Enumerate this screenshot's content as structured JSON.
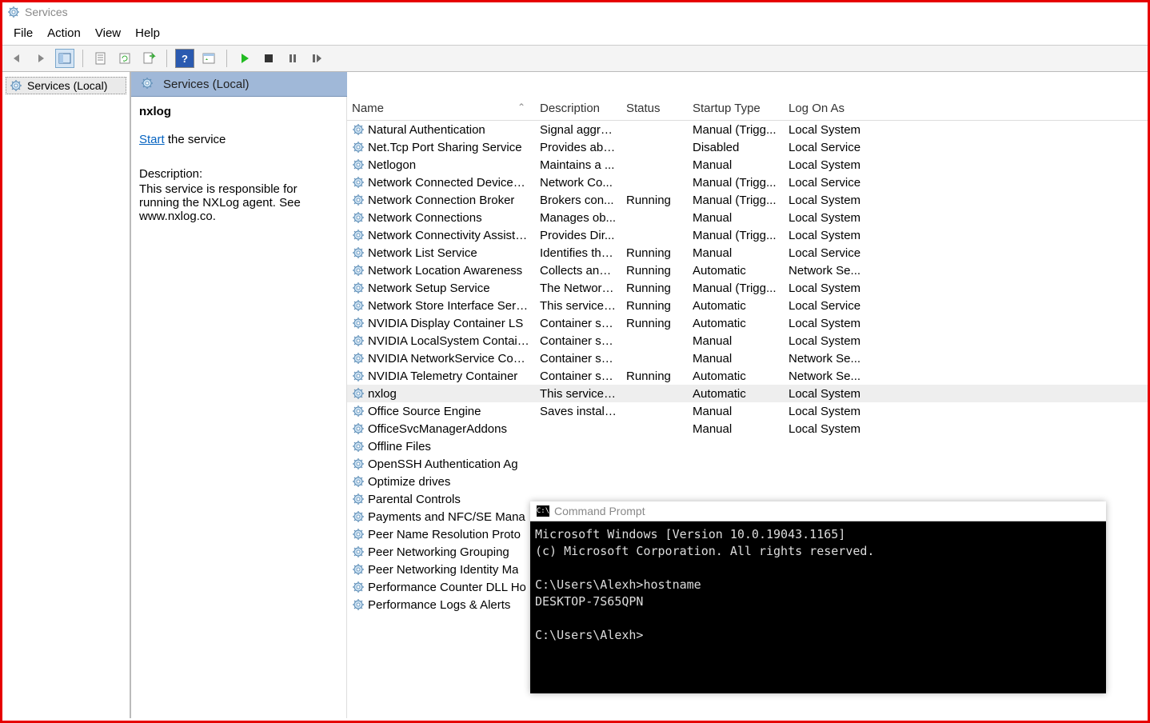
{
  "window": {
    "title": "Services"
  },
  "menu": {
    "file": "File",
    "action": "Action",
    "view": "View",
    "help": "Help"
  },
  "tree": {
    "root": "Services (Local)"
  },
  "main_header": "Services (Local)",
  "detail": {
    "service_name": "nxlog",
    "start_link": "Start",
    "start_suffix": " the service",
    "desc_label": "Description:",
    "description": "This service is responsible for running the NXLog agent. See www.nxlog.co."
  },
  "columns": {
    "name": "Name",
    "description": "Description",
    "status": "Status",
    "startup": "Startup Type",
    "logon": "Log On As"
  },
  "services": [
    {
      "name": "Natural Authentication",
      "desc": "Signal aggre...",
      "status": "",
      "startup": "Manual (Trigg...",
      "logon": "Local System",
      "sel": false
    },
    {
      "name": "Net.Tcp Port Sharing Service",
      "desc": "Provides abil...",
      "status": "",
      "startup": "Disabled",
      "logon": "Local Service",
      "sel": false
    },
    {
      "name": "Netlogon",
      "desc": "Maintains a ...",
      "status": "",
      "startup": "Manual",
      "logon": "Local System",
      "sel": false
    },
    {
      "name": "Network Connected Devices ...",
      "desc": "Network Co...",
      "status": "",
      "startup": "Manual (Trigg...",
      "logon": "Local Service",
      "sel": false
    },
    {
      "name": "Network Connection Broker",
      "desc": "Brokers con...",
      "status": "Running",
      "startup": "Manual (Trigg...",
      "logon": "Local System",
      "sel": false
    },
    {
      "name": "Network Connections",
      "desc": "Manages ob...",
      "status": "",
      "startup": "Manual",
      "logon": "Local System",
      "sel": false
    },
    {
      "name": "Network Connectivity Assistant",
      "desc": "Provides Dir...",
      "status": "",
      "startup": "Manual (Trigg...",
      "logon": "Local System",
      "sel": false
    },
    {
      "name": "Network List Service",
      "desc": "Identifies the...",
      "status": "Running",
      "startup": "Manual",
      "logon": "Local Service",
      "sel": false
    },
    {
      "name": "Network Location Awareness",
      "desc": "Collects and ...",
      "status": "Running",
      "startup": "Automatic",
      "logon": "Network Se...",
      "sel": false
    },
    {
      "name": "Network Setup Service",
      "desc": "The Network...",
      "status": "Running",
      "startup": "Manual (Trigg...",
      "logon": "Local System",
      "sel": false
    },
    {
      "name": "Network Store Interface Servi...",
      "desc": "This service ...",
      "status": "Running",
      "startup": "Automatic",
      "logon": "Local Service",
      "sel": false
    },
    {
      "name": "NVIDIA Display Container LS",
      "desc": "Container se...",
      "status": "Running",
      "startup": "Automatic",
      "logon": "Local System",
      "sel": false
    },
    {
      "name": "NVIDIA LocalSystem Container",
      "desc": "Container se...",
      "status": "",
      "startup": "Manual",
      "logon": "Local System",
      "sel": false
    },
    {
      "name": "NVIDIA NetworkService Cont...",
      "desc": "Container se...",
      "status": "",
      "startup": "Manual",
      "logon": "Network Se...",
      "sel": false
    },
    {
      "name": "NVIDIA Telemetry Container",
      "desc": "Container se...",
      "status": "Running",
      "startup": "Automatic",
      "logon": "Network Se...",
      "sel": false
    },
    {
      "name": "nxlog",
      "desc": "This service i...",
      "status": "",
      "startup": "Automatic",
      "logon": "Local System",
      "sel": true
    },
    {
      "name": "Office  Source Engine",
      "desc": "Saves install...",
      "status": "",
      "startup": "Manual",
      "logon": "Local System",
      "sel": false
    },
    {
      "name": "OfficeSvcManagerAddons",
      "desc": "",
      "status": "",
      "startup": "Manual",
      "logon": "Local System",
      "sel": false
    },
    {
      "name": "Offline Files",
      "desc": "",
      "status": "",
      "startup": "",
      "logon": "",
      "sel": false
    },
    {
      "name": "OpenSSH Authentication Ag",
      "desc": "",
      "status": "",
      "startup": "",
      "logon": "",
      "sel": false
    },
    {
      "name": "Optimize drives",
      "desc": "",
      "status": "",
      "startup": "",
      "logon": "",
      "sel": false
    },
    {
      "name": "Parental Controls",
      "desc": "",
      "status": "",
      "startup": "",
      "logon": "",
      "sel": false
    },
    {
      "name": "Payments and NFC/SE Mana",
      "desc": "",
      "status": "",
      "startup": "",
      "logon": "",
      "sel": false
    },
    {
      "name": "Peer Name Resolution Proto",
      "desc": "",
      "status": "",
      "startup": "",
      "logon": "",
      "sel": false
    },
    {
      "name": "Peer Networking Grouping",
      "desc": "",
      "status": "",
      "startup": "",
      "logon": "",
      "sel": false
    },
    {
      "name": "Peer Networking Identity Ma",
      "desc": "",
      "status": "",
      "startup": "",
      "logon": "",
      "sel": false
    },
    {
      "name": "Performance Counter DLL Ho",
      "desc": "",
      "status": "",
      "startup": "",
      "logon": "",
      "sel": false
    },
    {
      "name": "Performance Logs & Alerts",
      "desc": "",
      "status": "",
      "startup": "",
      "logon": "",
      "sel": false
    }
  ],
  "cmd": {
    "title": "Command Prompt",
    "lines": "Microsoft Windows [Version 10.0.19043.1165]\n(c) Microsoft Corporation. All rights reserved.\n\nC:\\Users\\Alexh>hostname\nDESKTOP-7S65QPN\n\nC:\\Users\\Alexh>"
  }
}
